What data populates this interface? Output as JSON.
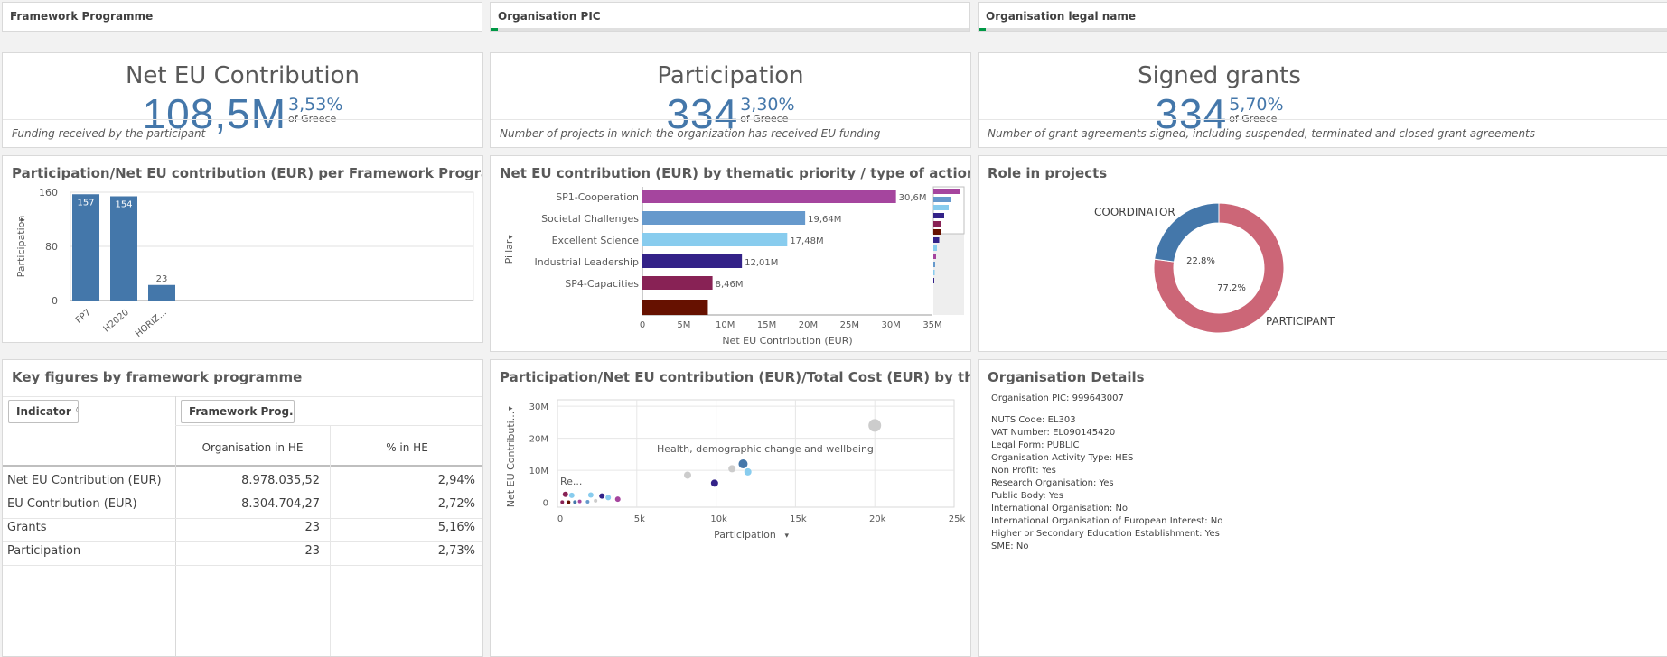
{
  "filters": {
    "framework": "Framework Programme",
    "pic": "Organisation PIC",
    "legal": "Organisation legal name"
  },
  "kpis": [
    {
      "title": "Net EU Contribution",
      "value": "108,5M",
      "pct": "3,53%",
      "of": "of Greece",
      "foot": "Funding received by the participant"
    },
    {
      "title": "Participation",
      "value": "334",
      "pct": "3,30%",
      "of": "of Greece",
      "foot": "Number of projects in which the organization has received EU funding"
    },
    {
      "title": "Signed grants",
      "value": "334",
      "pct": "5,70%",
      "of": "of Greece",
      "foot": "Number of grant agreements signed, including suspended, terminated and closed grant agreements"
    }
  ],
  "panel_titles": {
    "fp_chart": "Participation/Net EU contribution (EUR) per Framework Programme",
    "pillar_chart": "Net EU contribution (EUR) by thematic priority / type of action / pillar",
    "role": "Role in projects",
    "key_figures": "Key figures by framework programme",
    "scatter": "Participation/Net EU contribution (EUR)/Total Cost (EUR) by thematic priority",
    "details": "Organisation Details"
  },
  "chart_data": [
    {
      "type": "bar",
      "categories": [
        "FP7",
        "H2020",
        "HORIZ..."
      ],
      "values": [
        157,
        154,
        23
      ],
      "ylabel": "Participation",
      "ylim": [
        0,
        160
      ],
      "yticks": [
        "160",
        "80",
        "0"
      ],
      "color": "#4477aa"
    },
    {
      "type": "bar",
      "orientation": "horizontal",
      "categories": [
        "SP1-Cooperation",
        "Societal Challenges",
        "Excellent Science",
        "Industrial Leadership",
        "SP4-Capacities",
        ""
      ],
      "values": [
        30.6,
        19.64,
        17.48,
        12.01,
        8.46,
        7.9
      ],
      "labels": [
        "30,6M",
        "19,64M",
        "17,48M",
        "12,01M",
        "8,46M",
        ""
      ],
      "colors": [
        "#a5459e",
        "#6699cc",
        "#88ccee",
        "#332288",
        "#882255",
        "#661100"
      ],
      "xlabel": "Net EU Contribution (EUR)",
      "ylabel": "Pillar",
      "xlim": [
        0,
        35
      ],
      "xticks": [
        "0",
        "5M",
        "10M",
        "15M",
        "20M",
        "25M",
        "30M",
        "35M"
      ]
    },
    {
      "type": "pie",
      "donut": true,
      "slices": [
        {
          "name": "COORDINATOR",
          "value": 22.8,
          "label": "22.8%",
          "color": "#4477aa"
        },
        {
          "name": "PARTICIPANT",
          "value": 77.2,
          "label": "77.2%",
          "color": "#cc6677"
        }
      ]
    },
    {
      "type": "scatter",
      "xlabel": "Participation",
      "ylabel": "Net EU Contributi...",
      "xlim": [
        0,
        25000
      ],
      "ylim": [
        -1500000,
        32000000
      ],
      "xticks": [
        "0",
        "5k",
        "10k",
        "15k",
        "20k",
        "25k"
      ],
      "yticks": [
        "30M",
        "20M",
        "10M",
        "0"
      ],
      "annotations": [
        "Health, demographic change and wellbeing",
        "Re..."
      ],
      "points": [
        {
          "x": 20000,
          "y": 24000000,
          "r": 7,
          "color": "#cccccc"
        },
        {
          "x": 11700,
          "y": 12000000,
          "r": 5,
          "color": "#4477aa"
        },
        {
          "x": 11000,
          "y": 10500000,
          "r": 4,
          "color": "#cccccc"
        },
        {
          "x": 12000,
          "y": 9500000,
          "r": 4,
          "color": "#88ccee"
        },
        {
          "x": 8200,
          "y": 8500000,
          "r": 4,
          "color": "#cccccc"
        },
        {
          "x": 9900,
          "y": 6000000,
          "r": 4,
          "color": "#332288"
        },
        {
          "x": 500,
          "y": 2500000,
          "r": 3,
          "color": "#882255"
        },
        {
          "x": 900,
          "y": 2200000,
          "r": 3,
          "color": "#88ccee"
        },
        {
          "x": 2100,
          "y": 2300000,
          "r": 3,
          "color": "#88ccee"
        },
        {
          "x": 2800,
          "y": 2000000,
          "r": 3,
          "color": "#332288"
        },
        {
          "x": 3200,
          "y": 1500000,
          "r": 3,
          "color": "#88ccee"
        },
        {
          "x": 3800,
          "y": 1000000,
          "r": 3,
          "color": "#a5459e"
        },
        {
          "x": 1400,
          "y": 300000,
          "r": 2,
          "color": "#a5459e"
        },
        {
          "x": 1900,
          "y": 200000,
          "r": 2,
          "color": "#6699cc"
        },
        {
          "x": 300,
          "y": 100000,
          "r": 2,
          "color": "#882255"
        },
        {
          "x": 700,
          "y": 50000,
          "r": 2,
          "color": "#661100"
        },
        {
          "x": 1100,
          "y": 100000,
          "r": 2,
          "color": "#4477aa"
        },
        {
          "x": 2400,
          "y": 500000,
          "r": 2,
          "color": "#cccccc"
        }
      ]
    }
  ],
  "key_figures": {
    "search1": "Indicator",
    "search2": "Framework Prog...",
    "col1": "Organisation in HE",
    "col2": "% in HE",
    "rows": [
      {
        "label": "Net EU Contribution (EUR)",
        "v1": "8.978.035,52",
        "v2": "2,94%"
      },
      {
        "label": "EU Contribution (EUR)",
        "v1": "8.304.704,27",
        "v2": "2,72%"
      },
      {
        "label": "Grants",
        "v1": "23",
        "v2": "5,16%"
      },
      {
        "label": "Participation",
        "v1": "23",
        "v2": "2,73%"
      }
    ]
  },
  "details": {
    "pic": "Organisation PIC: 999643007",
    "lines": [
      "NUTS Code: EL303",
      "VAT Number: EL090145420",
      "Legal Form: PUBLIC",
      "Organisation Activity Type: HES",
      "Non Profit: Yes",
      "Research Organisation: Yes",
      "Public Body: Yes",
      "International Organisation: No",
      "International Organisation of European Interest: No",
      "Higher or Secondary Education Establishment: Yes",
      "SME: No"
    ]
  }
}
